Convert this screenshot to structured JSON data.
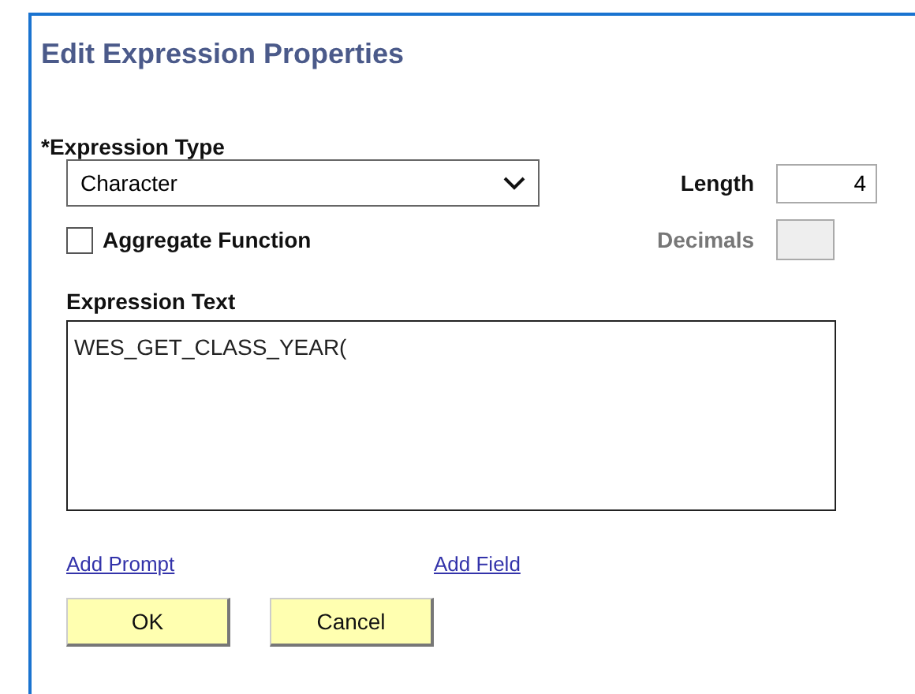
{
  "window": {
    "title": "Edit Expression Properties"
  },
  "expression_type": {
    "label": "*Expression Type",
    "value": "Character"
  },
  "length": {
    "label": "Length",
    "value": "4"
  },
  "aggregate_function": {
    "label": "Aggregate Function",
    "checked": false
  },
  "decimals": {
    "label": "Decimals",
    "disabled": true
  },
  "expression_text": {
    "label": "Expression Text",
    "value": "WES_GET_CLASS_YEAR("
  },
  "links": [
    "Add Prompt",
    "Add Field"
  ],
  "buttons": [
    "OK",
    "Cancel"
  ]
}
